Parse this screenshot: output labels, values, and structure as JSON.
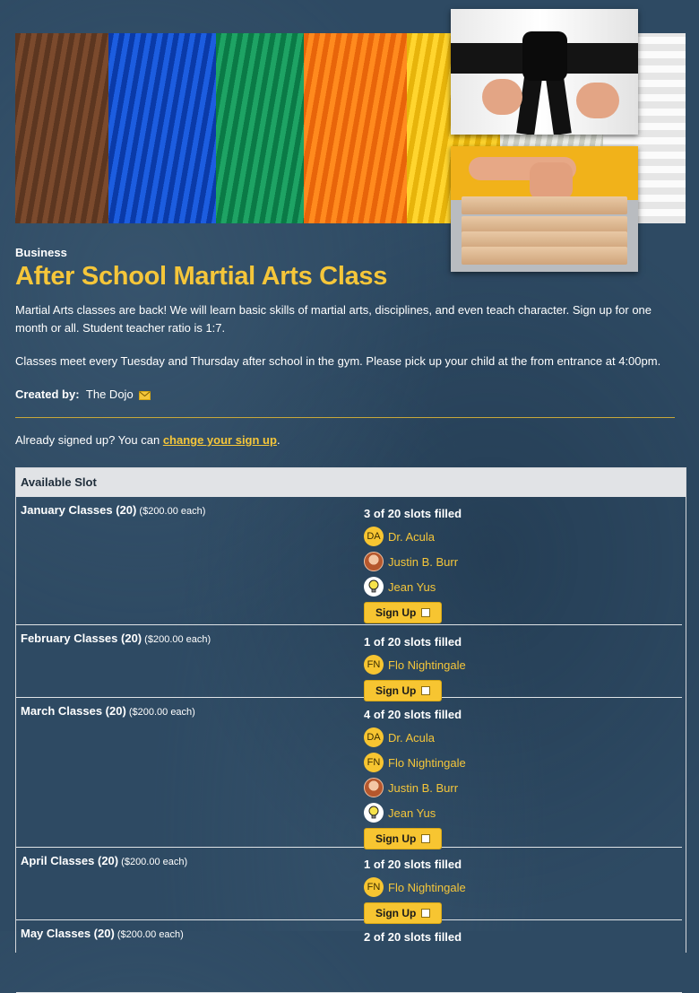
{
  "header": {
    "category": "Business",
    "title": "After School Martial Arts Class",
    "description": "Martial Arts classes are back!  We will learn basic skills of martial arts, disciplines, and even teach character. Sign up for one month or all. Student teacher ratio is 1:7.",
    "schedule": "Classes meet every Tuesday and Thursday after school in the gym.  Please pick up your child at the from entrance at 4:00pm.",
    "created_by_label": "Created by:",
    "created_by_name": "The Dojo"
  },
  "already": {
    "text": "Already signed up? You can ",
    "link": "change your sign up",
    "after": "."
  },
  "table": {
    "header": "Available Slot",
    "signup_label": "Sign Up",
    "slots": [
      {
        "name": "January Classes (20)",
        "price": "($200.00 each)",
        "filled": "3 of 20 slots filled",
        "people": [
          {
            "initials": "DA",
            "name": "Dr. Acula",
            "avatar": "initials"
          },
          {
            "initials": "",
            "name": "Justin B. Burr",
            "avatar": "photo"
          },
          {
            "initials": "",
            "name": "Jean Yus",
            "avatar": "bulb"
          }
        ]
      },
      {
        "name": "February Classes (20)",
        "price": "($200.00 each)",
        "filled": "1 of 20 slots filled",
        "people": [
          {
            "initials": "FN",
            "name": "Flo Nightingale",
            "avatar": "initials"
          }
        ]
      },
      {
        "name": "March Classes (20)",
        "price": "($200.00 each)",
        "filled": "4 of 20 slots filled",
        "people": [
          {
            "initials": "DA",
            "name": "Dr. Acula",
            "avatar": "initials"
          },
          {
            "initials": "FN",
            "name": "Flo Nightingale",
            "avatar": "initials"
          },
          {
            "initials": "",
            "name": "Justin B. Burr",
            "avatar": "photo"
          },
          {
            "initials": "",
            "name": "Jean Yus",
            "avatar": "bulb"
          }
        ]
      },
      {
        "name": "April Classes (20)",
        "price": "($200.00 each)",
        "filled": "1 of 20 slots filled",
        "people": [
          {
            "initials": "FN",
            "name": "Flo Nightingale",
            "avatar": "initials"
          }
        ]
      },
      {
        "name": "May Classes (20)",
        "price": "($200.00 each)",
        "filled": "2 of 20 slots filled",
        "people": []
      }
    ]
  },
  "colors": {
    "background": "#2e4a63",
    "accent": "#f5c63a",
    "button": "#f7c531"
  }
}
